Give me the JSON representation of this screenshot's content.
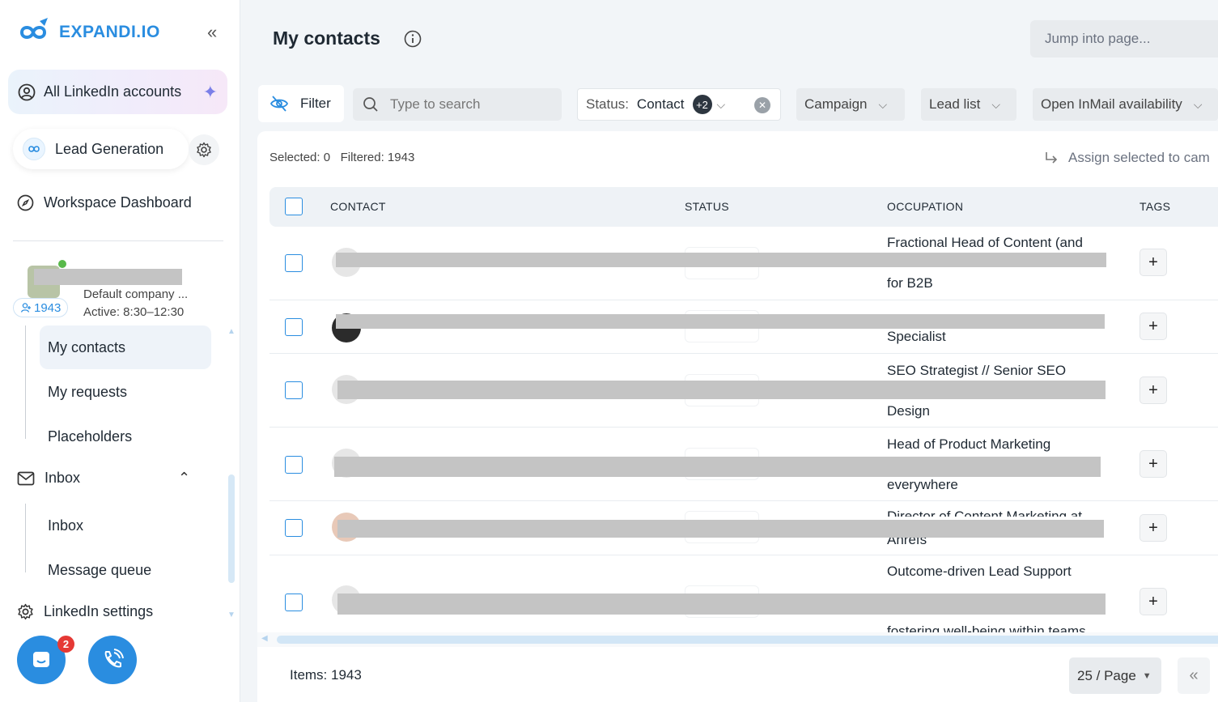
{
  "app": {
    "brand": "EXPANDI.IO",
    "accent": "#2a8de0"
  },
  "sidebar": {
    "accounts_label": "All LinkedIn accounts",
    "workspace_label": "Lead Generation",
    "dashboard_label": "Workspace Dashboard",
    "account": {
      "count": "1943",
      "company": "Default company ...",
      "active": "Active: 8:30–12:30"
    },
    "contacts_items": [
      {
        "label": "My contacts",
        "active": true
      },
      {
        "label": "My requests",
        "active": false
      },
      {
        "label": "Placeholders",
        "active": false
      }
    ],
    "inbox_label": "Inbox",
    "inbox_items": [
      {
        "label": "Inbox"
      },
      {
        "label": "Message queue"
      }
    ],
    "settings_label": "LinkedIn settings",
    "chat_badge": "2"
  },
  "header": {
    "title": "My contacts",
    "jump_placeholder": "Jump into page..."
  },
  "toolbar": {
    "filter_label": "Filter",
    "search_placeholder": "Type to search",
    "status_key": "Status:",
    "status_value": "Contact",
    "status_extra": "+2",
    "campaign_label": "Campaign",
    "lead_list_label": "Lead list",
    "inmail_label": "Open InMail availability"
  },
  "table": {
    "selected_text": "Selected: 0",
    "filtered_text": "Filtered: 1943",
    "assign_text": "Assign selected to cam",
    "columns": [
      "CONTACT",
      "STATUS",
      "OCCUPATION",
      "TAGS"
    ],
    "rows": [
      {
        "occupation_top": "Fractional Head of Content (and",
        "occupation_bottom": "for B2B"
      },
      {
        "occupation_top": "",
        "occupation_bottom": "Specialist"
      },
      {
        "occupation_top": "SEO Strategist // Senior SEO",
        "occupation_bottom": "Design"
      },
      {
        "occupation_top": "Head of Product Marketing",
        "occupation_bottom": "everywhere"
      },
      {
        "occupation_top": "Director of Content Marketing at",
        "occupation_bottom": "Ahrefs"
      },
      {
        "occupation_top": "Outcome-driven Lead Support",
        "occupation_bottom": "fostering well-being within teams"
      }
    ]
  },
  "footer": {
    "items_text": "Items: 1943",
    "page_size": "25 / Page"
  }
}
